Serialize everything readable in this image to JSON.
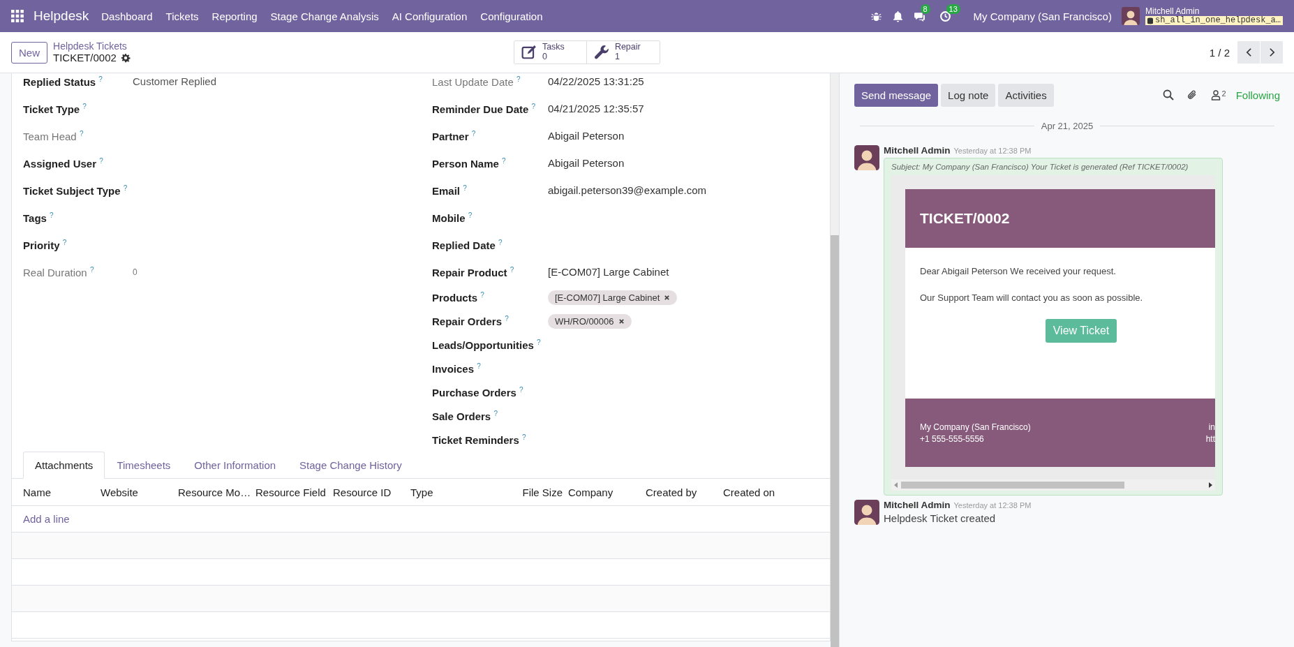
{
  "navbar": {
    "app": "Helpdesk",
    "menu": [
      "Dashboard",
      "Tickets",
      "Reporting",
      "Stage Change Analysis",
      "AI Configuration",
      "Configuration"
    ],
    "chat_count": "8",
    "activity_count": "13",
    "company": "My Company (San Francisco)",
    "user": "Mitchell Admin",
    "database": "sh_all_in_one_helpdesk_a…"
  },
  "control_panel": {
    "new_button": "New",
    "breadcrumb": "Helpdesk Tickets",
    "record": "TICKET/0002",
    "smart_buttons": [
      {
        "kind": "tasks",
        "label": "Tasks",
        "value": "0"
      },
      {
        "kind": "repair",
        "label": "Repair",
        "value": "1"
      }
    ],
    "pager": "1 / 2"
  },
  "form": {
    "left_fields": [
      {
        "label": "Replied Status",
        "help": "?",
        "value": "Customer Replied",
        "readonly": false
      },
      {
        "label": "Ticket Type",
        "help": "?",
        "readonly": false
      },
      {
        "label": "Team Head",
        "help": "?",
        "readonly": true
      },
      {
        "label": "Assigned User",
        "help": "?",
        "readonly": false
      },
      {
        "label": "Ticket Subject Type",
        "help": "?",
        "readonly": false
      },
      {
        "label": "Tags",
        "help": "?",
        "readonly": false
      },
      {
        "label": "Priority",
        "help": "?",
        "readonly": false
      },
      {
        "label": "Real Duration",
        "help": "?",
        "value": "0",
        "readonly": true
      }
    ],
    "right_fields": [
      {
        "label": "Last Update Date",
        "help": "?",
        "value": "04/22/2025 13:31:25",
        "readonly": true,
        "kind": "text"
      },
      {
        "label": "Reminder Due Date",
        "help": "?",
        "value": "04/21/2025 12:35:57",
        "readonly": false,
        "kind": "text"
      },
      {
        "label": "Partner",
        "help": "?",
        "value": "Abigail Peterson",
        "readonly": false,
        "kind": "text"
      },
      {
        "label": "Person Name",
        "help": "?",
        "value": "Abigail Peterson",
        "readonly": false,
        "kind": "text"
      },
      {
        "label": "Email",
        "help": "?",
        "value": "abigail.peterson39@example.com",
        "readonly": false,
        "kind": "text"
      },
      {
        "label": "Mobile",
        "help": "?",
        "readonly": false,
        "kind": "text"
      },
      {
        "label": "Replied Date",
        "help": "?",
        "readonly": false,
        "kind": "text"
      },
      {
        "label": "Repair Product",
        "help": "?",
        "value": "[E-COM07] Large Cabinet",
        "readonly": false,
        "kind": "text"
      },
      {
        "label": "Products",
        "help": "?",
        "tags": [
          "[E-COM07] Large Cabinet"
        ],
        "readonly": false,
        "kind": "tags"
      },
      {
        "label": "Repair Orders",
        "help": "?",
        "tags": [
          "WH/RO/00006"
        ],
        "readonly": false,
        "kind": "tags"
      },
      {
        "label": "Leads/Opportunities",
        "help": "?",
        "readonly": false,
        "kind": "text"
      },
      {
        "label": "Invoices",
        "help": "?",
        "readonly": false,
        "kind": "text"
      },
      {
        "label": "Purchase Orders",
        "help": "?",
        "readonly": false,
        "kind": "text"
      },
      {
        "label": "Sale Orders",
        "help": "?",
        "readonly": false,
        "kind": "text"
      },
      {
        "label": "Ticket Reminders",
        "help": "?",
        "readonly": false,
        "kind": "text"
      }
    ],
    "tabs": [
      {
        "label": "Attachments",
        "selected": true
      },
      {
        "label": "Timesheets",
        "selected": false
      },
      {
        "label": "Other Information",
        "selected": false
      },
      {
        "label": "Stage Change History",
        "selected": false
      }
    ],
    "table": {
      "columns": [
        "Name",
        "Website",
        "Resource Mo…",
        "Resource Field",
        "Resource ID",
        "Type",
        "File Size",
        "Company",
        "Created by",
        "Created on"
      ],
      "add_line": "Add a line"
    }
  },
  "chatter": {
    "buttons": [
      {
        "label": "Send message",
        "selected": true
      },
      {
        "label": "Log note",
        "selected": false
      },
      {
        "label": "Activities",
        "selected": false
      }
    ],
    "followers_count": "2",
    "follow_status": "Following",
    "date_separator": "Apr 21, 2025",
    "messages": [
      {
        "kind": "email",
        "author": "Mitchell Admin",
        "time": "Yesterday at 12:38 PM",
        "subject": "Subject: My Company (San Francisco) Your Ticket is generated (Ref TICKET/0002)",
        "email": {
          "title": "TICKET/0002",
          "paragraphs": [
            "Dear Abigail Peterson We received your request.",
            "Our Support Team will contact you as soon as possible."
          ],
          "button": "View Ticket",
          "footer_left": [
            "My Company (San Francisco)",
            "+1 555-555-5556"
          ],
          "footer_right": [
            "in",
            "htt"
          ]
        }
      },
      {
        "kind": "note",
        "author": "Mitchell Admin",
        "time": "Yesterday at 12:38 PM",
        "body": "Helpdesk Ticket created"
      }
    ]
  }
}
